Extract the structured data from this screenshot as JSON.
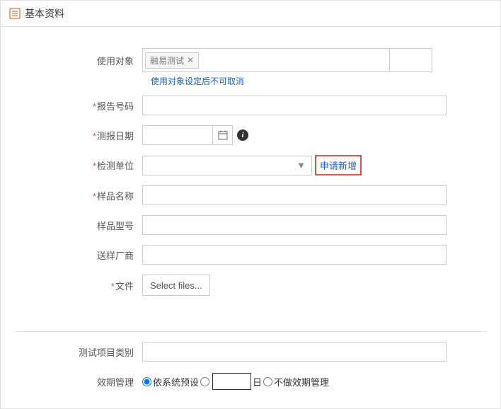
{
  "header": {
    "title": "基本资料"
  },
  "form": {
    "usage_target": {
      "label": "使用对象",
      "tag": "融易测试",
      "hint": "使用对象设定后不可取消"
    },
    "report_no": {
      "label": "报告号码"
    },
    "report_date": {
      "label": "测报日期"
    },
    "detect_unit": {
      "label": "检测单位",
      "apply_new": "申请新增"
    },
    "sample_name": {
      "label": "样品名称"
    },
    "sample_model": {
      "label": "样品型号"
    },
    "vendor": {
      "label": "送样厂商"
    },
    "file": {
      "label": "文件",
      "button": "Select files..."
    },
    "test_category": {
      "label": "测试项目类别"
    },
    "expiry": {
      "label": "效期管理",
      "opt_default": "依系统预设",
      "day_unit": "日",
      "opt_none": "不做效期管理"
    }
  }
}
